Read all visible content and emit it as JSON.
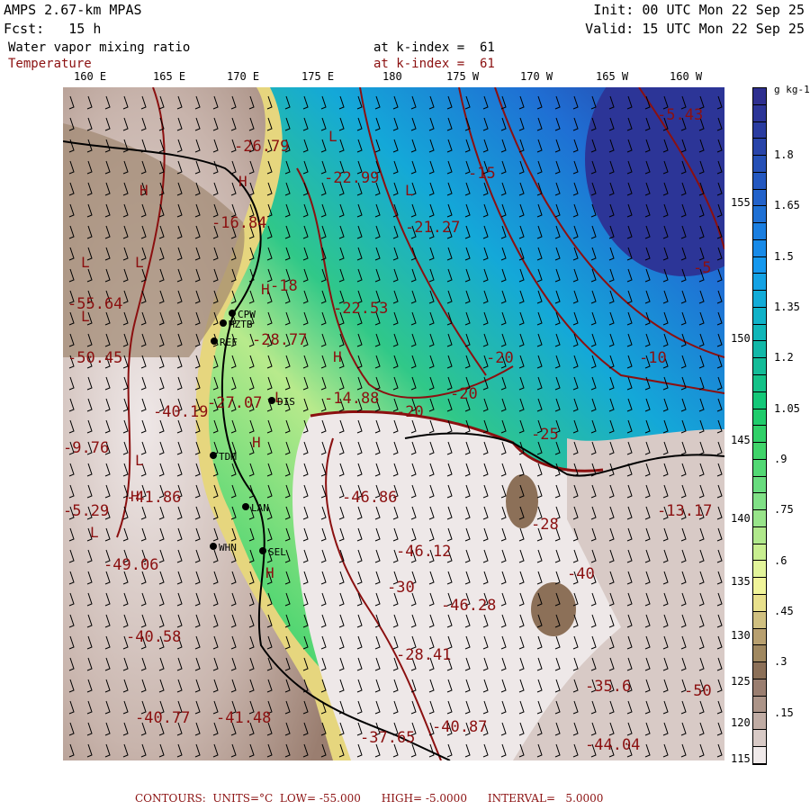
{
  "header": {
    "model": "AMPS 2.67-km MPAS",
    "forecast": "Fcst:   15 h",
    "init": "Init: 00 UTC Mon 22 Sep 25",
    "valid": "Valid: 15 UTC Mon 22 Sep 25",
    "field1": "Water vapor mixing ratio",
    "field1_level": "at k-index =  61",
    "field2": "Temperature",
    "field2_level": "at k-index =  61"
  },
  "longitudes": [
    "160 E",
    "165 E",
    "170 E",
    "175 E",
    "180",
    "175 W",
    "170 W",
    "165 W",
    "160 W"
  ],
  "latitudes": [
    "155",
    "150",
    "145",
    "140",
    "135",
    "130",
    "125",
    "120",
    "115"
  ],
  "colorbar": {
    "units": "g kg-1",
    "labels": [
      "1.8",
      "1.65",
      "1.5",
      "1.35",
      "1.2",
      "1.05",
      ".9",
      ".75",
      ".6",
      ".45",
      ".3",
      ".15"
    ],
    "colors": [
      "#2e2f8f",
      "#2c3597",
      "#2a3ca0",
      "#2844a9",
      "#2650b6",
      "#2458c0",
      "#2262ca",
      "#1f70d4",
      "#1a7ee0",
      "#178ae8",
      "#1598ee",
      "#14a2e4",
      "#12acd8",
      "#10b2c8",
      "#10b6b8",
      "#12b8a8",
      "#14bc98",
      "#14c288",
      "#14c878",
      "#20cc6c",
      "#30d068",
      "#40d46a",
      "#52d874",
      "#68dc7e",
      "#80e086",
      "#98e48a",
      "#b0e88c",
      "#c8ee90",
      "#e2f49a",
      "#f0f49a",
      "#e8e08c",
      "#d0c080",
      "#b8a070",
      "#a08860",
      "#8c7058",
      "#9a7e70",
      "#ac9488",
      "#c0aca4",
      "#d8cac6",
      "#f0eaea"
    ]
  },
  "stations": [
    "CPW",
    "MZTB",
    "REF",
    "DIS",
    "TDM",
    "LAN",
    "WHN",
    "SEL"
  ],
  "temp_labels": [
    "-26.79",
    "-22.99",
    "-21.27",
    "-16.84",
    "-18",
    "-22.53",
    "-55.64",
    "-28.77",
    "-50.45",
    "-27.07",
    "-14.88",
    "-20",
    "-20",
    "-20",
    "-40.19",
    "-9.76",
    "-41.86",
    "-46.86",
    "-46.12",
    "-5.29",
    "-49.06",
    "-40.58",
    "-46.28",
    "-28.41",
    "-30",
    "-40.77",
    "-41.48",
    "-37.65",
    "-40.87",
    "-44.04",
    "-35.6",
    "-13.17",
    "-28",
    "-40",
    "-15",
    "-10",
    "-5",
    "-25",
    "-5.43",
    "-50"
  ],
  "pressure_marks": [
    "L",
    "L",
    "L",
    "H",
    "H",
    "H",
    "L",
    "L",
    "H",
    "L",
    "L",
    "H",
    "L",
    "H",
    "H"
  ],
  "footer": "CONTOURS:  UNITS=°C  LOW= -55.000      HIGH= -5.0000      INTERVAL=   5.0000"
}
